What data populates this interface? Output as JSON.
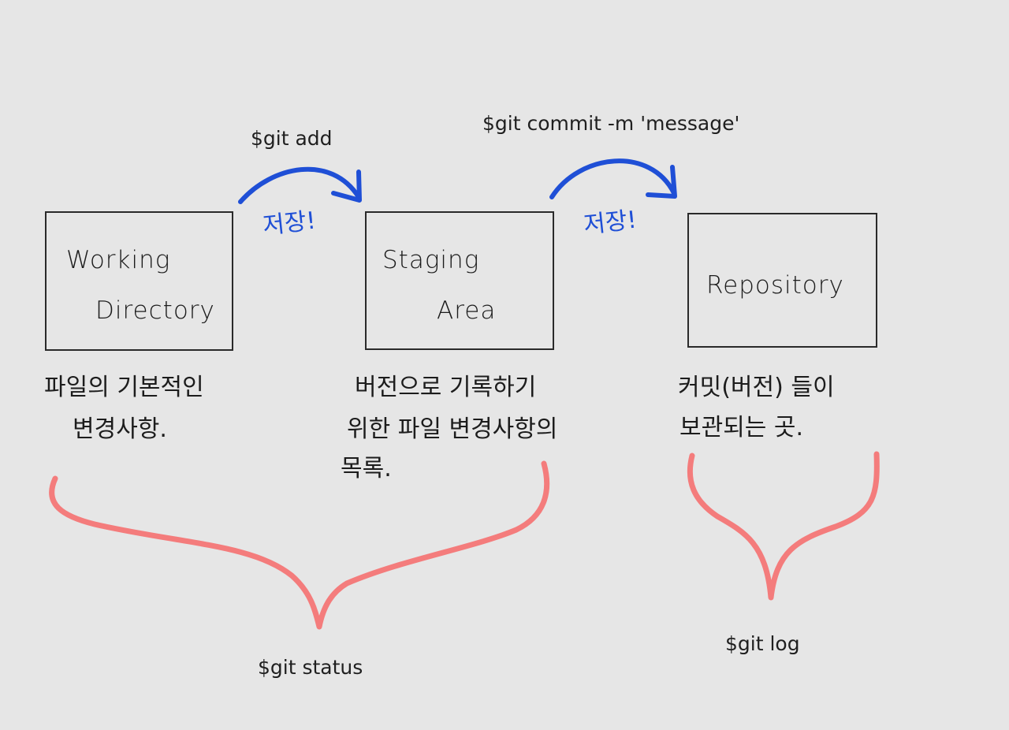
{
  "commands": {
    "git_add": "$git add",
    "git_commit": "$git commit -m 'message'",
    "git_status": "$git status",
    "git_log": "$git log"
  },
  "boxes": {
    "working_directory": [
      "Working",
      "Directory"
    ],
    "staging_area": [
      "Staging",
      "Area"
    ],
    "repository": [
      "Repository"
    ]
  },
  "save_labels": {
    "first": "저장!",
    "second": "저장!"
  },
  "descriptions": {
    "working_directory": [
      "파일의 기본적인",
      "변경사항."
    ],
    "staging_area": [
      "버전으로 기록하기",
      "위한 파일 변경사항의",
      "목록."
    ],
    "repository": [
      "커밋(버전) 들이",
      "보관되는 곳."
    ]
  },
  "colors": {
    "arrow": "#1f4fd6",
    "brace": "#f47c7c",
    "box_border": "#2a2a2a",
    "background": "#e6e6e6"
  }
}
